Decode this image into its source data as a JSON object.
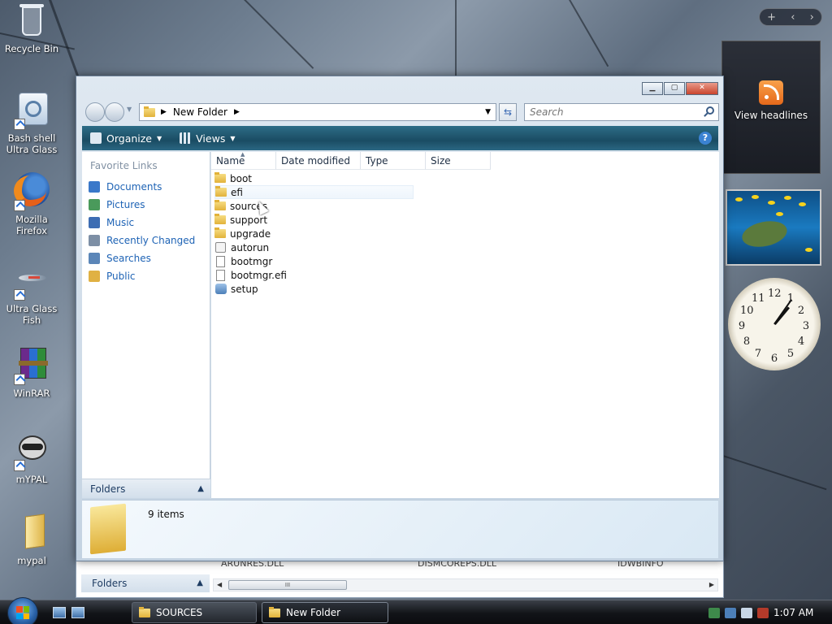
{
  "desktop": {
    "icons": [
      {
        "label": "Recycle Bin",
        "icon": "recycle-bin-icon"
      },
      {
        "label": "Bash shell Ultra Glass",
        "icon": "bash-shell-icon"
      },
      {
        "label": "Mozilla Firefox",
        "icon": "firefox-icon"
      },
      {
        "label": "Ultra Glass Fish",
        "icon": "fish-icon"
      },
      {
        "label": "WinRAR",
        "icon": "winrar-icon"
      },
      {
        "label": "mYPAL",
        "icon": "raccoon-icon"
      },
      {
        "label": "mypal",
        "icon": "folder-icon"
      }
    ]
  },
  "sidebar": {
    "feed_label": "View headlines",
    "clock_numbers": [
      "12",
      "1",
      "2",
      "3",
      "4",
      "5",
      "6",
      "7",
      "8",
      "9",
      "10",
      "11"
    ]
  },
  "explorer": {
    "address": "New Folder",
    "search_placeholder": "Search",
    "toolbar": {
      "organize": "Organize",
      "views": "Views"
    },
    "favorite_links_heading": "Favorite Links",
    "favorite_links": [
      {
        "label": "Documents",
        "color": "#3a78c9"
      },
      {
        "label": "Pictures",
        "color": "#4a9a5b"
      },
      {
        "label": "Music",
        "color": "#3d6db3"
      },
      {
        "label": "Recently Changed",
        "color": "#7d8fa5"
      },
      {
        "label": "Searches",
        "color": "#5b86b8"
      },
      {
        "label": "Public",
        "color": "#e0b143"
      }
    ],
    "folders_label": "Folders",
    "columns": [
      "Name",
      "Date modified",
      "Type",
      "Size"
    ],
    "files": [
      {
        "name": "boot",
        "kind": "folder"
      },
      {
        "name": "efi",
        "kind": "folder"
      },
      {
        "name": "sources",
        "kind": "folder"
      },
      {
        "name": "support",
        "kind": "folder"
      },
      {
        "name": "upgrade",
        "kind": "folder"
      },
      {
        "name": "autorun",
        "kind": "config"
      },
      {
        "name": "bootmgr",
        "kind": "file"
      },
      {
        "name": "bootmgr.efi",
        "kind": "file"
      },
      {
        "name": "setup",
        "kind": "app"
      }
    ],
    "item_count": "9 items"
  },
  "background_window": {
    "ghost_files": [
      "ARUNRES.DLL",
      "DISMCOREPS.DLL",
      "IDWBINFO"
    ],
    "folders_label": "Folders",
    "scroll_thumb": "III"
  },
  "taskbar": {
    "buttons": [
      {
        "label": "SOURCES"
      },
      {
        "label": "New Folder"
      }
    ],
    "clock": "1:07 AM"
  }
}
